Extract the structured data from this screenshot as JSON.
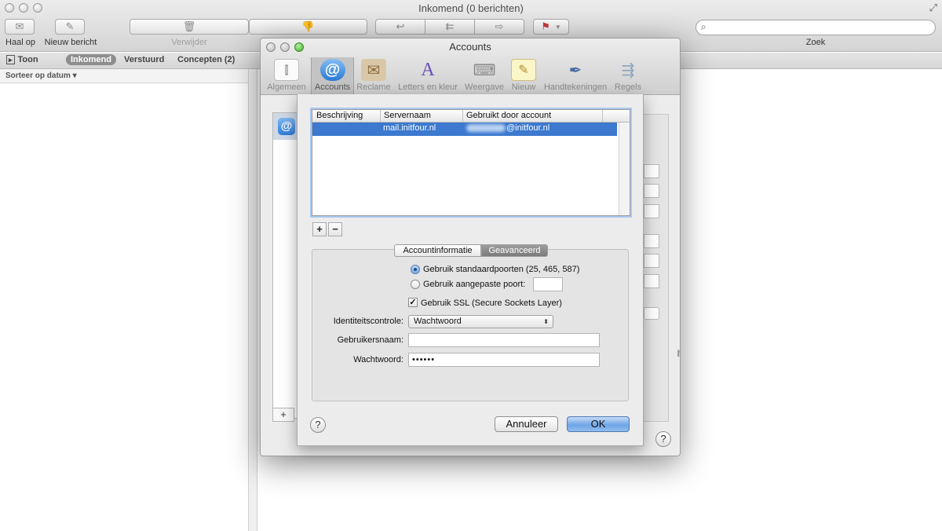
{
  "mail_window": {
    "title": "Inkomend (0 berichten)",
    "toolbar": {
      "get_mail": "Haal op",
      "new_message": "Nieuw bericht",
      "delete": "Verwijder",
      "search_label": "Zoek"
    },
    "favorites": {
      "show": "Toon",
      "inbox": "Inkomend",
      "sent": "Verstuurd",
      "drafts": "Concepten (2)"
    },
    "sort_label": "Sorteer op datum ▾"
  },
  "prefs_window": {
    "title": "Accounts",
    "tabs": [
      {
        "label": "Algemeen",
        "icon": "switch-icon"
      },
      {
        "label": "Accounts",
        "icon": "at-icon"
      },
      {
        "label": "Reclame",
        "icon": "junk-mail-icon"
      },
      {
        "label": "Letters en kleur",
        "icon": "fonts-colors-icon"
      },
      {
        "label": "Weergave",
        "icon": "viewing-icon"
      },
      {
        "label": "Nieuw",
        "icon": "composing-icon"
      },
      {
        "label": "Handtekeningen",
        "icon": "signatures-icon"
      },
      {
        "label": "Regels",
        "icon": "rules-icon"
      }
    ],
    "account_icon": "@",
    "add_account": "+",
    "help": "?",
    "background_text": "rd"
  },
  "smtp_sheet": {
    "table": {
      "columns": [
        "Beschrijving",
        "Servernaam",
        "Gebruikt door account"
      ],
      "rows": [
        {
          "description": "",
          "server": "mail.initfour.nl",
          "account_suffix": "@initfour.nl"
        }
      ]
    },
    "add": "+",
    "remove": "−",
    "tabs": [
      "Accountinformatie",
      "Geavanceerd"
    ],
    "radio_default_ports": "Gebruik standaardpoorten (25, 465, 587)",
    "radio_custom_port": "Gebruik aangepaste poort:",
    "checkbox_ssl": "Gebruik SSL (Secure Sockets Layer)",
    "auth_label": "Identiteitscontrole:",
    "auth_value": "Wachtwoord",
    "username_label": "Gebruikersnaam:",
    "username_value": "",
    "password_label": "Wachtwoord:",
    "password_value": "••••••",
    "help": "?",
    "cancel": "Annuleer",
    "ok": "OK"
  }
}
